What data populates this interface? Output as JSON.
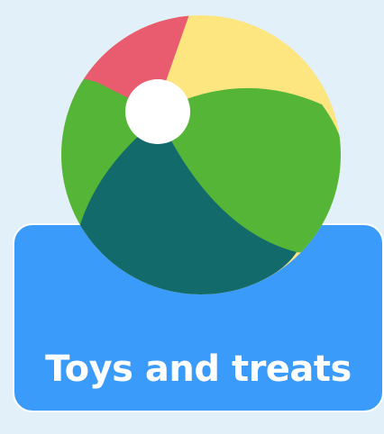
{
  "category_tile": {
    "label": "Toys and treats",
    "icon": "beach-ball-icon"
  },
  "colors": {
    "page_background": "#e2f0f9",
    "tile_background": "#3a9bfa",
    "label_text": "#ffffff",
    "ball_red": "#e95b6e",
    "ball_yellow": "#fde580",
    "ball_green": "#54b537",
    "ball_teal": "#136a6a",
    "ball_cap": "#ffffff"
  }
}
